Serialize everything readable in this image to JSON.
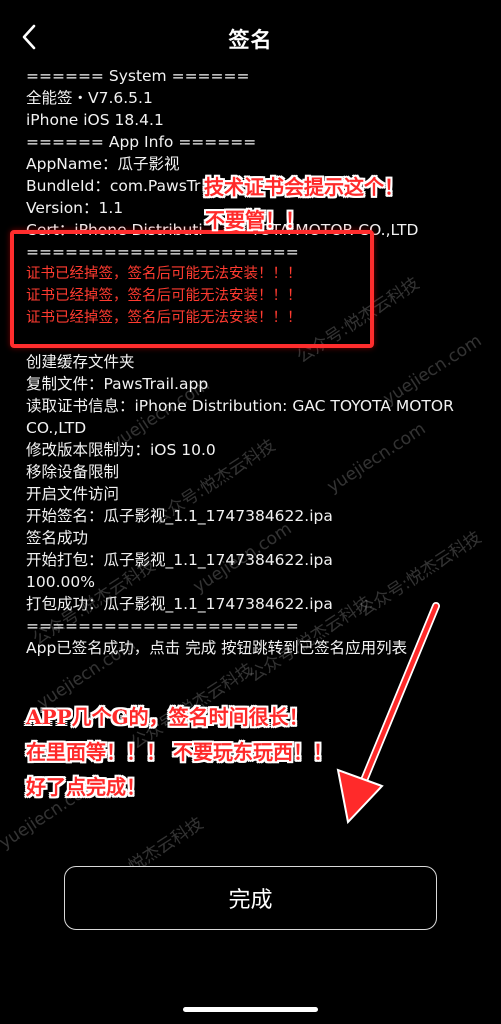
{
  "nav": {
    "back_icon": "chevron-left-icon",
    "title": "签名"
  },
  "log": {
    "system_header": "====== System ======",
    "app_version": "全能签・V7.6.5.1",
    "device": "iPhone iOS 18.4.1",
    "appinfo_header": "====== App Info ======",
    "app_name": "AppName：瓜子影视",
    "bundle_id": "BundleId：com.PawsTr",
    "version": "Version：1.1",
    "cert": "Cert：iPhone Distributi",
    "cert_tail": "YOTA MOTOR CO.,LTD",
    "separator": "=====================",
    "warnings": [
      "证书已经掉签，签名后可能无法安装！！！",
      "证书已经掉签，签名后可能无法安装！！！",
      "证书已经掉签，签名后可能无法安装！！！"
    ],
    "steps": [
      "创建缓存文件夹",
      "复制文件：PawsTrail.app",
      "读取证书信息：iPhone Distribution: GAC TOYOTA MOTOR CO.,LTD",
      "修改版本限制为：iOS 10.0",
      "移除设备限制",
      "开启文件访问",
      "开始签名：瓜子影视_1.1_1747384622.ipa",
      "签名成功",
      "开始打包：瓜子影视_1.1_1747384622.ipa",
      "100.00%",
      "打包成功：瓜子影视_1.1_1747384622.ipa"
    ],
    "end_separator": "=====================",
    "final_message": "App已签名成功，点击 完成 按钮跳转到已签名应用列表"
  },
  "annotations": {
    "top_line1": "技术证书会提示这个！",
    "top_line2": "不要管！！",
    "bottom_line1": "APP几个G的，签名时间很长！",
    "bottom_line2": "在里面等！！！ 不要玩东玩西！！",
    "bottom_line3": "好了点完成！",
    "color": "#ff2a2a"
  },
  "watermark": {
    "site": "yuejiecn.com",
    "account": "公众号:悦杰云科技"
  },
  "done_button": {
    "label": "完成"
  },
  "colors": {
    "background": "#000000",
    "text": "#ffffff",
    "error": "#ff3b30",
    "highlight_border": "#ff2d2d"
  }
}
